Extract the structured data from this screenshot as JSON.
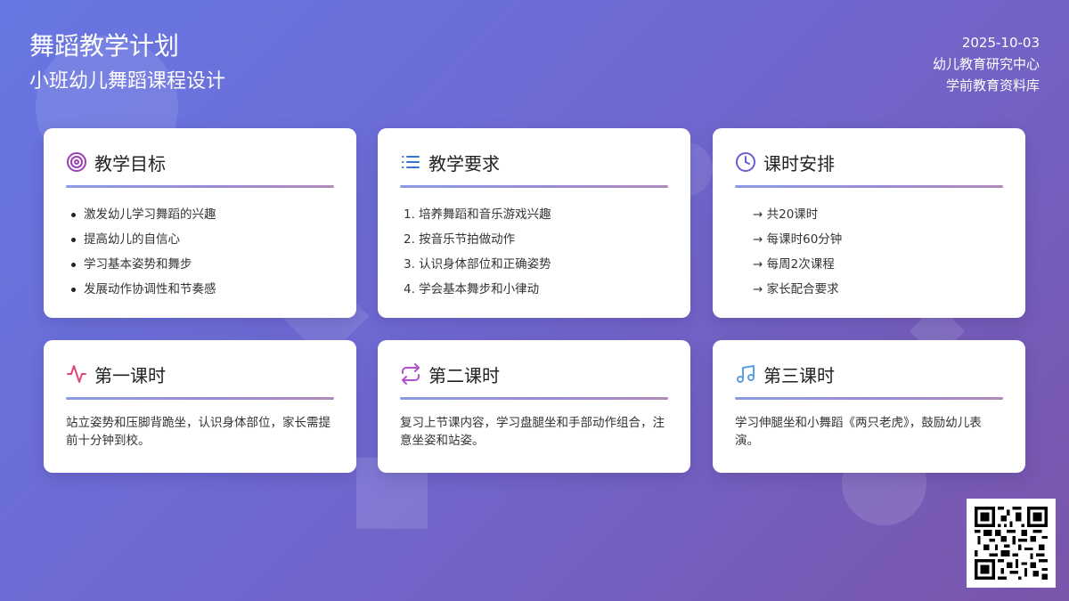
{
  "header": {
    "title": "舞蹈教学计划",
    "subtitle": "小班幼儿舞蹈课程设计",
    "date": "2025-10-03",
    "org": "幼儿教育研究中心",
    "source": "学前教育资料库"
  },
  "cards": {
    "goals": {
      "title": "教学目标",
      "icon": "target-icon",
      "items": [
        "激发幼儿学习舞蹈的兴趣",
        "提高幼儿的自信心",
        "学习基本姿势和舞步",
        "发展动作协调性和节奏感"
      ]
    },
    "requirements": {
      "title": "教学要求",
      "icon": "list-icon",
      "items": [
        "1. 培养舞蹈和音乐游戏兴趣",
        "2. 按音乐节拍做动作",
        "3. 认识身体部位和正确姿势",
        "4. 学会基本舞步和小律动"
      ]
    },
    "schedule": {
      "title": "课时安排",
      "icon": "clock-icon",
      "items": [
        "→ 共20课时",
        "→ 每课时60分钟",
        "→ 每周2次课程",
        "→ 家长配合要求"
      ]
    },
    "lesson1": {
      "title": "第一课时",
      "icon": "pulse-icon",
      "text": "站立姿势和压脚背跪坐，认识身体部位，家长需提前十分钟到校。"
    },
    "lesson2": {
      "title": "第二课时",
      "icon": "repeat-icon",
      "text": "复习上节课内容，学习盘腿坐和手部动作组合，注意坐姿和站姿。"
    },
    "lesson3": {
      "title": "第三课时",
      "icon": "music-note-icon",
      "text": "学习伸腿坐和小舞蹈《两只老虎》，鼓励幼儿表演。"
    }
  },
  "colors": {
    "background_start": "#6777e3",
    "background_end": "#7a55ab",
    "target": "#9b3fb5",
    "list": "#3a73d6",
    "clock": "#6a5fd0",
    "pulse": "#e0457a",
    "repeat": "#b34fd0",
    "music": "#5a9fe0"
  }
}
